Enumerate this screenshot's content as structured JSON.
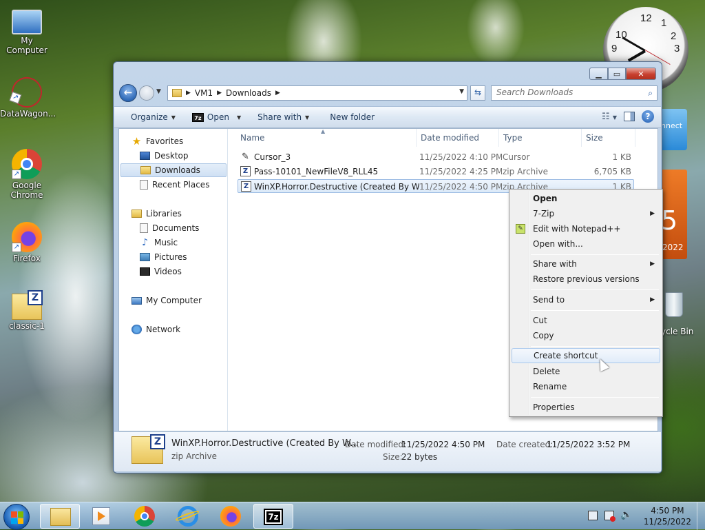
{
  "desktop": {
    "icons": [
      {
        "label": "My Computer"
      },
      {
        "label": "DataWagon..."
      },
      {
        "label": "Google Chrome"
      },
      {
        "label": "Firefox"
      },
      {
        "label": "classic-1"
      }
    ],
    "partial_labels": {
      "connect": "nnect",
      "calendar_day": "5",
      "calendar_year": "2022",
      "recycle_bin": "ycle Bin"
    },
    "clock_numbers": [
      "12",
      "1",
      "2",
      "3",
      "10",
      "9"
    ]
  },
  "window": {
    "address": {
      "segments": [
        "VM1",
        "Downloads"
      ]
    },
    "search": {
      "placeholder": "Search Downloads"
    },
    "toolbar": {
      "organize": "Organize",
      "open": "Open",
      "open_icon_text": "7z",
      "share_with": "Share with",
      "new_folder": "New folder"
    },
    "nav": {
      "favorites": "Favorites",
      "desktop": "Desktop",
      "downloads": "Downloads",
      "recent_places": "Recent Places",
      "libraries": "Libraries",
      "documents": "Documents",
      "music": "Music",
      "pictures": "Pictures",
      "videos": "Videos",
      "my_computer": "My Computer",
      "network": "Network"
    },
    "columns": {
      "name": "Name",
      "date": "Date modified",
      "type": "Type",
      "size": "Size"
    },
    "files": [
      {
        "name": "Cursor_3",
        "date": "11/25/2022 4:10 PM",
        "type": "Cursor",
        "size": "1 KB",
        "icon": "cursor-icon"
      },
      {
        "name": "Pass-10101_NewFileV8_RLL45",
        "date": "11/25/2022 4:25 PM",
        "type": "zip Archive",
        "size": "6,705 KB",
        "icon": "zip-icon"
      },
      {
        "name": "WinXP.Horror.Destructive  (Created By W...",
        "date": "11/25/2022 4:50 PM",
        "type": "zip Archive",
        "size": "1 KB",
        "icon": "zip-icon",
        "selected": true
      }
    ],
    "details": {
      "name": "WinXP.Horror.Destructive  (Created By W...",
      "type": "zip Archive",
      "modified_label": "Date modified:",
      "modified": "11/25/2022 4:50 PM",
      "size_label": "Size:",
      "size": "22 bytes",
      "created_label": "Date created:",
      "created": "11/25/2022 3:52 PM"
    }
  },
  "context_menu": {
    "open": "Open",
    "seven_zip": "7-Zip",
    "edit_npp": "Edit with Notepad++",
    "open_with": "Open with...",
    "share_with": "Share with",
    "restore": "Restore previous versions",
    "send_to": "Send to",
    "cut": "Cut",
    "copy": "Copy",
    "create_shortcut": "Create shortcut",
    "delete": "Delete",
    "rename": "Rename",
    "properties": "Properties",
    "hovered": "create_shortcut"
  },
  "taskbar": {
    "time": "4:50 PM",
    "date": "11/25/2022",
    "seven_zip_label": "7z"
  }
}
